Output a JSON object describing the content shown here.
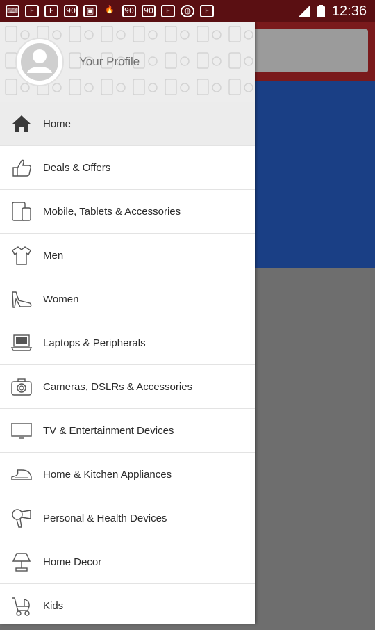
{
  "status_bar": {
    "time": "12:36",
    "notification_icons": [
      "keyboard-icon",
      "flipkart-icon",
      "flipkart-icon",
      "ninety-icon",
      "gallery-icon",
      "fire-icon",
      "ninety-icon",
      "ninety-icon",
      "flipkart-icon",
      "basketball-icon",
      "flipkart-icon"
    ]
  },
  "profile": {
    "name": "Your Profile"
  },
  "menu": {
    "items": [
      {
        "label": "Home",
        "icon": "home-icon",
        "active": true
      },
      {
        "label": "Deals & Offers",
        "icon": "thumbs-up-icon"
      },
      {
        "label": "Mobile, Tablets & Accessories",
        "icon": "mobile-tablet-icon"
      },
      {
        "label": "Men",
        "icon": "shirt-icon"
      },
      {
        "label": "Women",
        "icon": "high-heel-icon"
      },
      {
        "label": "Laptops & Peripherals",
        "icon": "laptop-icon"
      },
      {
        "label": "Cameras, DSLRs & Accessories",
        "icon": "camera-icon"
      },
      {
        "label": "TV & Entertainment Devices",
        "icon": "tv-icon"
      },
      {
        "label": "Home & Kitchen Appliances",
        "icon": "iron-icon"
      },
      {
        "label": "Personal & Health Devices",
        "icon": "hair-dryer-icon"
      },
      {
        "label": "Home Decor",
        "icon": "lamp-icon"
      },
      {
        "label": "Kids",
        "icon": "stroller-icon"
      }
    ]
  },
  "colors": {
    "status_bar": "#5a0f12",
    "scrim": "#6e6e6e",
    "drawer_bg": "#ffffff",
    "active_item_bg": "#ececec"
  }
}
